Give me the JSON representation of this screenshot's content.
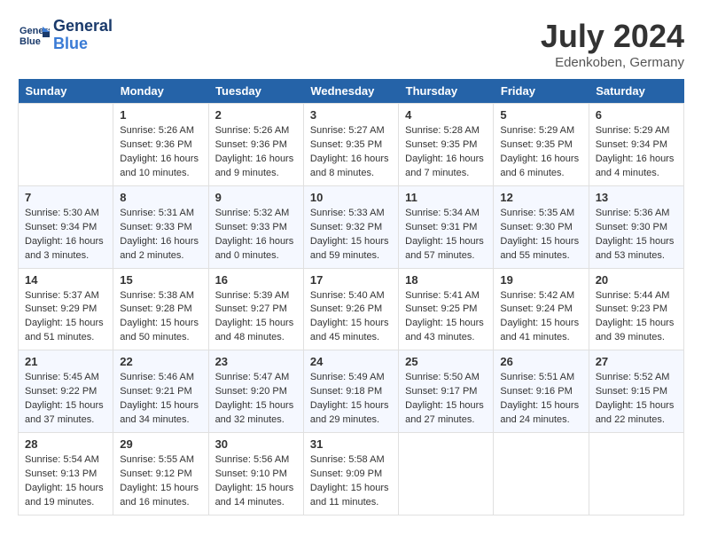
{
  "header": {
    "logo_line1": "General",
    "logo_line2": "Blue",
    "month_title": "July 2024",
    "location": "Edenkoben, Germany"
  },
  "days_of_week": [
    "Sunday",
    "Monday",
    "Tuesday",
    "Wednesday",
    "Thursday",
    "Friday",
    "Saturday"
  ],
  "weeks": [
    [
      {
        "day": "",
        "data": ""
      },
      {
        "day": "1",
        "data": "Sunrise: 5:26 AM\nSunset: 9:36 PM\nDaylight: 16 hours\nand 10 minutes."
      },
      {
        "day": "2",
        "data": "Sunrise: 5:26 AM\nSunset: 9:36 PM\nDaylight: 16 hours\nand 9 minutes."
      },
      {
        "day": "3",
        "data": "Sunrise: 5:27 AM\nSunset: 9:35 PM\nDaylight: 16 hours\nand 8 minutes."
      },
      {
        "day": "4",
        "data": "Sunrise: 5:28 AM\nSunset: 9:35 PM\nDaylight: 16 hours\nand 7 minutes."
      },
      {
        "day": "5",
        "data": "Sunrise: 5:29 AM\nSunset: 9:35 PM\nDaylight: 16 hours\nand 6 minutes."
      },
      {
        "day": "6",
        "data": "Sunrise: 5:29 AM\nSunset: 9:34 PM\nDaylight: 16 hours\nand 4 minutes."
      }
    ],
    [
      {
        "day": "7",
        "data": "Sunrise: 5:30 AM\nSunset: 9:34 PM\nDaylight: 16 hours\nand 3 minutes."
      },
      {
        "day": "8",
        "data": "Sunrise: 5:31 AM\nSunset: 9:33 PM\nDaylight: 16 hours\nand 2 minutes."
      },
      {
        "day": "9",
        "data": "Sunrise: 5:32 AM\nSunset: 9:33 PM\nDaylight: 16 hours\nand 0 minutes."
      },
      {
        "day": "10",
        "data": "Sunrise: 5:33 AM\nSunset: 9:32 PM\nDaylight: 15 hours\nand 59 minutes."
      },
      {
        "day": "11",
        "data": "Sunrise: 5:34 AM\nSunset: 9:31 PM\nDaylight: 15 hours\nand 57 minutes."
      },
      {
        "day": "12",
        "data": "Sunrise: 5:35 AM\nSunset: 9:30 PM\nDaylight: 15 hours\nand 55 minutes."
      },
      {
        "day": "13",
        "data": "Sunrise: 5:36 AM\nSunset: 9:30 PM\nDaylight: 15 hours\nand 53 minutes."
      }
    ],
    [
      {
        "day": "14",
        "data": "Sunrise: 5:37 AM\nSunset: 9:29 PM\nDaylight: 15 hours\nand 51 minutes."
      },
      {
        "day": "15",
        "data": "Sunrise: 5:38 AM\nSunset: 9:28 PM\nDaylight: 15 hours\nand 50 minutes."
      },
      {
        "day": "16",
        "data": "Sunrise: 5:39 AM\nSunset: 9:27 PM\nDaylight: 15 hours\nand 48 minutes."
      },
      {
        "day": "17",
        "data": "Sunrise: 5:40 AM\nSunset: 9:26 PM\nDaylight: 15 hours\nand 45 minutes."
      },
      {
        "day": "18",
        "data": "Sunrise: 5:41 AM\nSunset: 9:25 PM\nDaylight: 15 hours\nand 43 minutes."
      },
      {
        "day": "19",
        "data": "Sunrise: 5:42 AM\nSunset: 9:24 PM\nDaylight: 15 hours\nand 41 minutes."
      },
      {
        "day": "20",
        "data": "Sunrise: 5:44 AM\nSunset: 9:23 PM\nDaylight: 15 hours\nand 39 minutes."
      }
    ],
    [
      {
        "day": "21",
        "data": "Sunrise: 5:45 AM\nSunset: 9:22 PM\nDaylight: 15 hours\nand 37 minutes."
      },
      {
        "day": "22",
        "data": "Sunrise: 5:46 AM\nSunset: 9:21 PM\nDaylight: 15 hours\nand 34 minutes."
      },
      {
        "day": "23",
        "data": "Sunrise: 5:47 AM\nSunset: 9:20 PM\nDaylight: 15 hours\nand 32 minutes."
      },
      {
        "day": "24",
        "data": "Sunrise: 5:49 AM\nSunset: 9:18 PM\nDaylight: 15 hours\nand 29 minutes."
      },
      {
        "day": "25",
        "data": "Sunrise: 5:50 AM\nSunset: 9:17 PM\nDaylight: 15 hours\nand 27 minutes."
      },
      {
        "day": "26",
        "data": "Sunrise: 5:51 AM\nSunset: 9:16 PM\nDaylight: 15 hours\nand 24 minutes."
      },
      {
        "day": "27",
        "data": "Sunrise: 5:52 AM\nSunset: 9:15 PM\nDaylight: 15 hours\nand 22 minutes."
      }
    ],
    [
      {
        "day": "28",
        "data": "Sunrise: 5:54 AM\nSunset: 9:13 PM\nDaylight: 15 hours\nand 19 minutes."
      },
      {
        "day": "29",
        "data": "Sunrise: 5:55 AM\nSunset: 9:12 PM\nDaylight: 15 hours\nand 16 minutes."
      },
      {
        "day": "30",
        "data": "Sunrise: 5:56 AM\nSunset: 9:10 PM\nDaylight: 15 hours\nand 14 minutes."
      },
      {
        "day": "31",
        "data": "Sunrise: 5:58 AM\nSunset: 9:09 PM\nDaylight: 15 hours\nand 11 minutes."
      },
      {
        "day": "",
        "data": ""
      },
      {
        "day": "",
        "data": ""
      },
      {
        "day": "",
        "data": ""
      }
    ]
  ]
}
